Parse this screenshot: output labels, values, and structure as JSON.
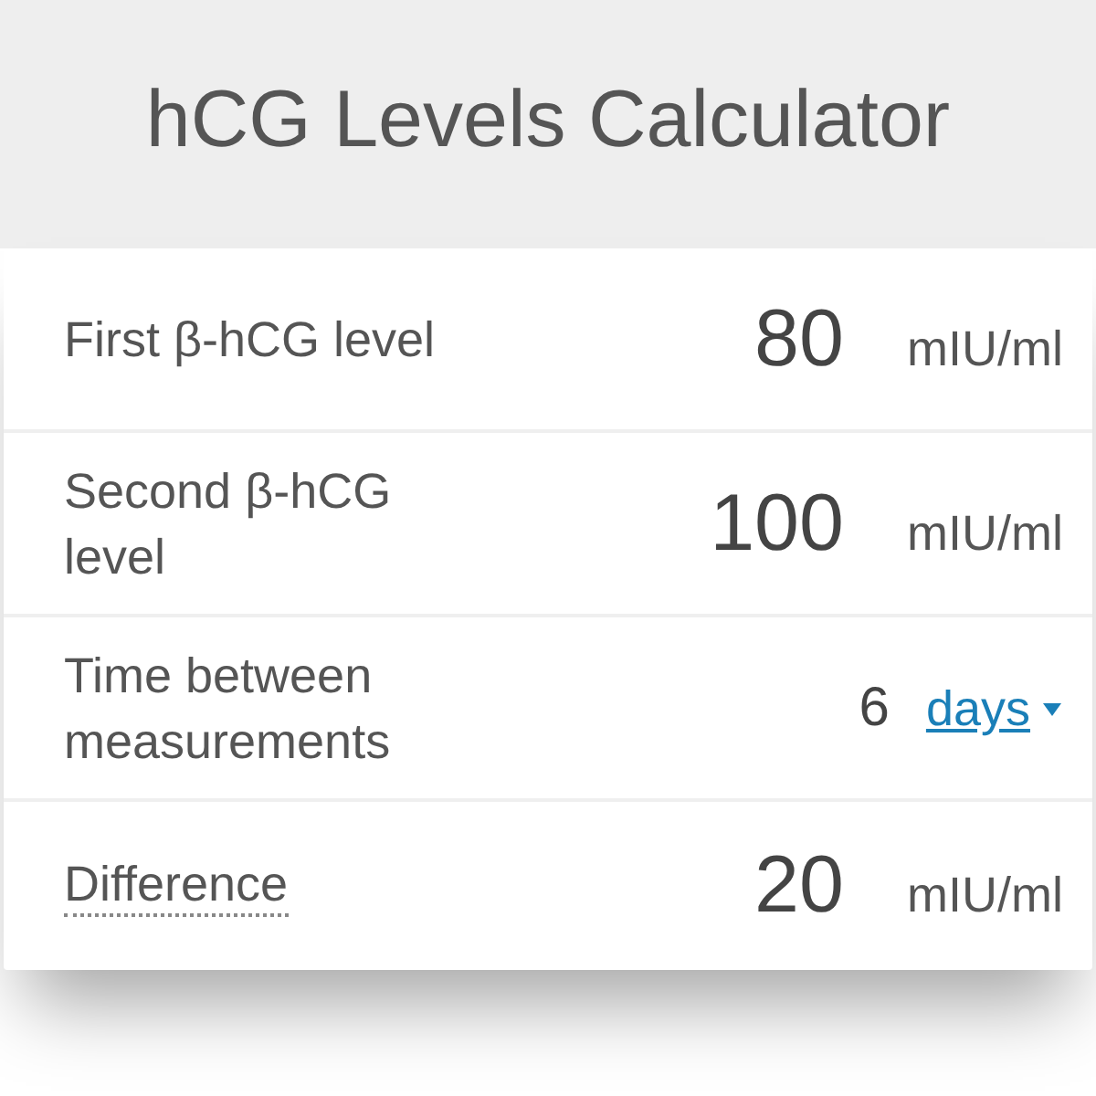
{
  "title": "hCG Levels Calculator",
  "rows": [
    {
      "kind": "unit",
      "label": "First β-hCG level",
      "has_tooltip": false,
      "value": "80",
      "unit": "mIU/ml"
    },
    {
      "kind": "unit",
      "label": "Second β-hCG level",
      "has_tooltip": false,
      "value": "100",
      "unit": "mIU/ml"
    },
    {
      "kind": "select",
      "label": "Time between measurements",
      "has_tooltip": false,
      "value": "6",
      "unit": "days"
    },
    {
      "kind": "unit",
      "label": "Difference",
      "has_tooltip": true,
      "value": "20",
      "unit": "mIU/ml"
    }
  ]
}
